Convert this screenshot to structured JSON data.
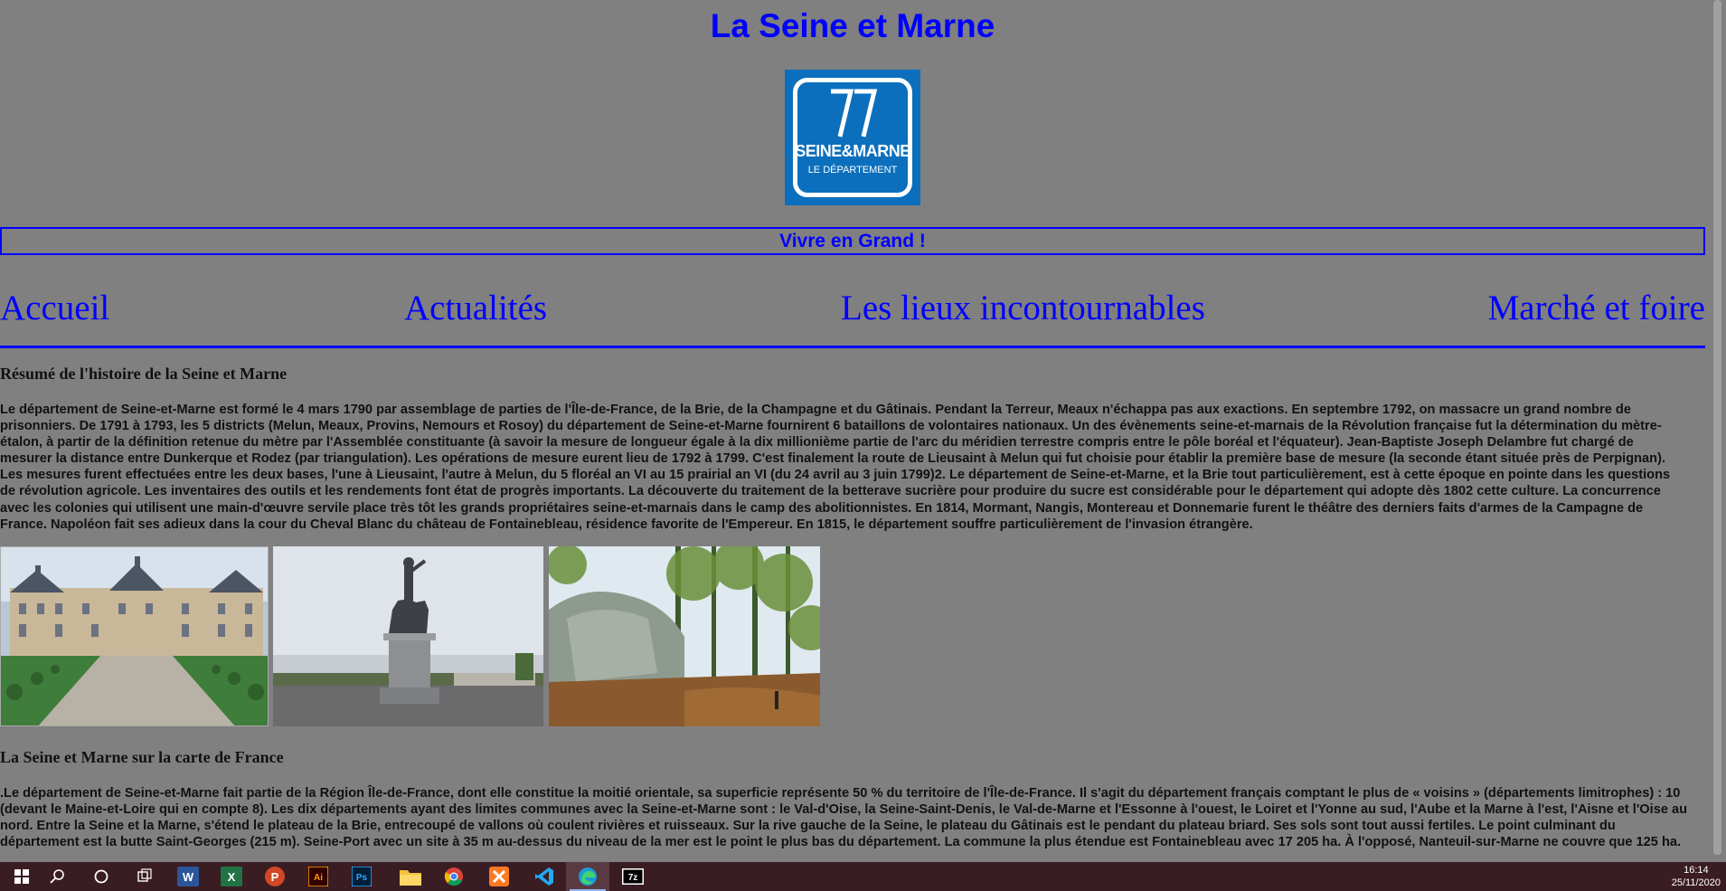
{
  "header": {
    "title": "La Seine et Marne",
    "logo_number": "77",
    "logo_line1": "SEINE&MARNE",
    "logo_line2": "LE DÉPARTEMENT",
    "slogan": "Vivre en Grand !"
  },
  "nav": {
    "items": [
      {
        "label": "Accueil"
      },
      {
        "label": "Actualités"
      },
      {
        "label": "Les lieux incontournables"
      },
      {
        "label": "Marché et foire"
      }
    ]
  },
  "section1": {
    "heading": "Résumé de l'histoire de la Seine et Marne",
    "lines": [
      "Le département de Seine-et-Marne est formé le 4 mars 1790 par assemblage de parties de l'Île-de-France, de la Brie, de la Champagne et du Gâtinais. Pendant la Terreur, Meaux n'échappa pas aux exactions. En septembre 1792, on massacre un grand nombre de",
      "prisonniers. De 1791 à 1793, les 5 districts (Melun, Meaux, Provins, Nemours et Rosoy) du département de Seine-et-Marne fournirent 6 bataillons de volontaires nationaux. Un des évènements seine-et-marnais de la Révolution française fut la détermination du mètre-",
      "étalon, à partir de la définition retenue du mètre par l'Assemblée constituante (à savoir la mesure de longueur égale à la dix millionième partie de l'arc du méridien terrestre compris entre le pôle boréal et l'équateur). Jean-Baptiste Joseph Delambre fut chargé de",
      "mesurer la distance entre Dunkerque et Rodez (par triangulation). Les opérations de mesure eurent lieu de 1792 à 1799. C'est finalement la route de Lieusaint à Melun qui fut choisie pour établir la première base de mesure (la seconde étant située près de Perpignan).",
      "Les mesures furent effectuées entre les deux bases, l'une à Lieusaint, l'autre à Melun, du 5 floréal an VI au 15 prairial an VI (du 24 avril au 3 juin 1799)2. Le département de Seine-et-Marne, et la Brie tout particulièrement, est à cette époque en pointe dans les questions",
      "de révolution agricole. Les inventaires des outils et les rendements font état de progrès importants. La découverte du traitement de la betterave sucrière pour produire du sucre est considérable pour le département qui adopte dès 1802 cette culture. La concurrence",
      "avec les colonies qui utilisent une main-d'œuvre servile place très tôt les grands propriétaires seine-et-marnais dans le camp des abolitionnistes. En 1814, Mormant, Nangis, Montereau et Donnemarie furent le théâtre des derniers faits d'armes de la Campagne de",
      "France. Napoléon fait ses adieux dans la cour du Cheval Blanc du château de Fontainebleau, résidence favorite de l'Empereur. En 1815, le département souffre particulièrement de l'invasion étrangère."
    ]
  },
  "section2": {
    "heading": "La Seine et Marne sur la carte de France",
    "lines": [
      ".Le département de Seine-et-Marne fait partie de la Région Île-de-France, dont elle constitue la moitié orientale, sa superficie représente 50 % du territoire de l'Île-de-France. Il s'agit du département français comptant le plus de « voisins » (départements limitrophes) : 10",
      "(devant le Maine-et-Loire qui en compte 8). Les dix départements ayant des limites communes avec la Seine-et-Marne sont : le Val-d'Oise, la Seine-Saint-Denis, le Val-de-Marne et l'Essonne à l'ouest, le Loiret et l'Yonne au sud, l'Aube et la Marne à l'est, l'Aisne et l'Oise au",
      "nord. Entre la Seine et la Marne, s'étend le plateau de la Brie, entrecoupé de vallons où coulent rivières et ruisseaux. Sur la rive gauche de la Seine, le plateau du Gâtinais est le pendant du plateau briard. Ses sols sont tout aussi fertiles. Le point culminant du",
      "département est la butte Saint-Georges (215 m). Seine-Port avec un site à 35 m au-dessus du niveau de la mer est le point le plus bas du département. La commune la plus étendue est Fontainebleau avec 17 205 ha. À l'opposé, Nanteuil-sur-Marne ne couvre que 125 ha."
    ]
  },
  "taskbar": {
    "icons": [
      "windows-start-icon",
      "search-icon",
      "cortana-icon",
      "task-view-icon",
      "word-icon",
      "excel-icon",
      "powerpoint-icon",
      "illustrator-icon",
      "photoshop-icon",
      "file-explorer-icon",
      "chrome-icon",
      "xampp-icon",
      "vscode-icon",
      "edge-icon",
      "7zip-icon"
    ],
    "word_letter": "W",
    "excel_letter": "X",
    "ppt_letter": "P",
    "ai_letter": "Ai",
    "ps_letter": "Ps",
    "zip_letter": "7z",
    "time": "16:14",
    "date": "25/11/2020"
  },
  "colors": {
    "background": "#808080",
    "link": "#0000ff",
    "taskbar": "#3a1c23",
    "logo_blue": "#0b6fbd"
  }
}
